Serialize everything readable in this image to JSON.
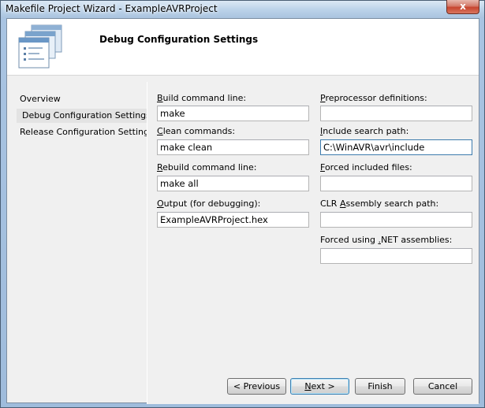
{
  "window": {
    "title": "Makefile Project Wizard - ExampleAVRProject",
    "close_label": "x"
  },
  "header": {
    "title": "Debug Configuration Settings",
    "icon": "wizard-settings-icon"
  },
  "sidebar": {
    "items": [
      {
        "label": "Overview",
        "selected": false
      },
      {
        "label": "Debug Configuration Settings",
        "selected": true
      },
      {
        "label": "Release Configuration Settings",
        "selected": false
      }
    ]
  },
  "fields": {
    "build_command": {
      "label_accel": "B",
      "label_rest": "uild command line:",
      "value": "make"
    },
    "clean_commands": {
      "label_accel": "C",
      "label_rest": "lean commands:",
      "value": "make clean"
    },
    "rebuild_command": {
      "label_accel": "R",
      "label_rest": "ebuild command line:",
      "value": "make all"
    },
    "output": {
      "label_accel": "O",
      "label_rest": "utput (for debugging):",
      "value": "ExampleAVRProject.hex"
    },
    "preprocessor": {
      "label_accel": "P",
      "label_rest": "reprocessor definitions:",
      "value": ""
    },
    "include_path": {
      "label_accel": "I",
      "label_rest": "nclude search path:",
      "value": "C:\\WinAVR\\avr\\include"
    },
    "forced_includes": {
      "label_accel": "F",
      "label_rest": "orced included files:",
      "value": ""
    },
    "clr_assembly": {
      "label_pre": "CLR ",
      "label_accel": "A",
      "label_rest": "ssembly search path:",
      "value": ""
    },
    "forced_net": {
      "label_pre": "Forced using ",
      "label_accel": ".",
      "label_rest": "NET assemblies:",
      "value": ""
    }
  },
  "buttons": {
    "previous": "< Previous",
    "next_accel": "N",
    "next_rest": "ext >",
    "finish": "Finish",
    "cancel": "Cancel"
  },
  "colors": {
    "selection_bg": "#e3e3e3",
    "focus_border": "#3d7bad",
    "default_button_border": "#3c7fb1"
  }
}
